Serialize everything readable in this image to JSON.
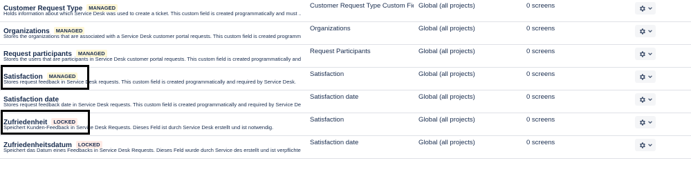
{
  "fields": [
    {
      "name": "Customer Request Type",
      "badge": "MANAGED",
      "description": "Holds information about which Service Desk was used to create a ticket. This custom field is created programmatically and must ...",
      "context": "Customer Request Type Custom Fie...",
      "scope": "Global (all projects)",
      "screens": "0 screens"
    },
    {
      "name": "Organizations",
      "badge": "MANAGED",
      "description": "Stores the organizations that are associated with a Service Desk customer portal requests. This custom field is created programmatically and ...",
      "context": "Organizations",
      "scope": "Global (all projects)",
      "screens": "0 screens"
    },
    {
      "name": "Request participants",
      "badge": "MANAGED",
      "description": "Stores the users that are participants in Service Desk customer portal requests. This custom field is created programmatically and ...",
      "context": "Request Participants",
      "scope": "Global (all projects)",
      "screens": "0 screens"
    },
    {
      "name": "Satisfaction",
      "badge": "MANAGED",
      "description": "Stores request feedback in Service Desk requests. This custom field is created programmatically and required by Service Desk.",
      "context": "Satisfaction",
      "scope": "Global (all projects)",
      "screens": "0 screens"
    },
    {
      "name": "Satisfaction date",
      "badge": "",
      "description": "Stores request feedback date in Service Desk requests. This custom field is created programmatically and required by Service Desk.",
      "context": "Satisfaction date",
      "scope": "Global (all projects)",
      "screens": "0 screens"
    },
    {
      "name": "Zufriedenheit",
      "badge": "LOCKED",
      "description": "Speichert Kunden-Feedback in Service Desk Requests. Dieses Feld ist durch Service Desk erstellt und ist notwendig.",
      "context": "Satisfaction",
      "scope": "Global (all projects)",
      "screens": "0 screens"
    },
    {
      "name": "Zufriedenheitsdatum",
      "badge": "LOCKED",
      "description": "Speichert das Datum eines Feedbacks in Service Desk Requests. Dieses Feld wurde durch Service des erstellt und ist verpflichtend.",
      "context": "Satisfaction date",
      "scope": "Global (all projects)",
      "screens": "0 screens"
    }
  ],
  "colors": {
    "managed_badge": "#fff7d6",
    "locked_badge": "#ffebe6",
    "text": "#172b4d",
    "divider": "#dfe1e6"
  },
  "icons": {
    "actions": "gear-icon",
    "dropdown": "chevron-down-icon"
  }
}
